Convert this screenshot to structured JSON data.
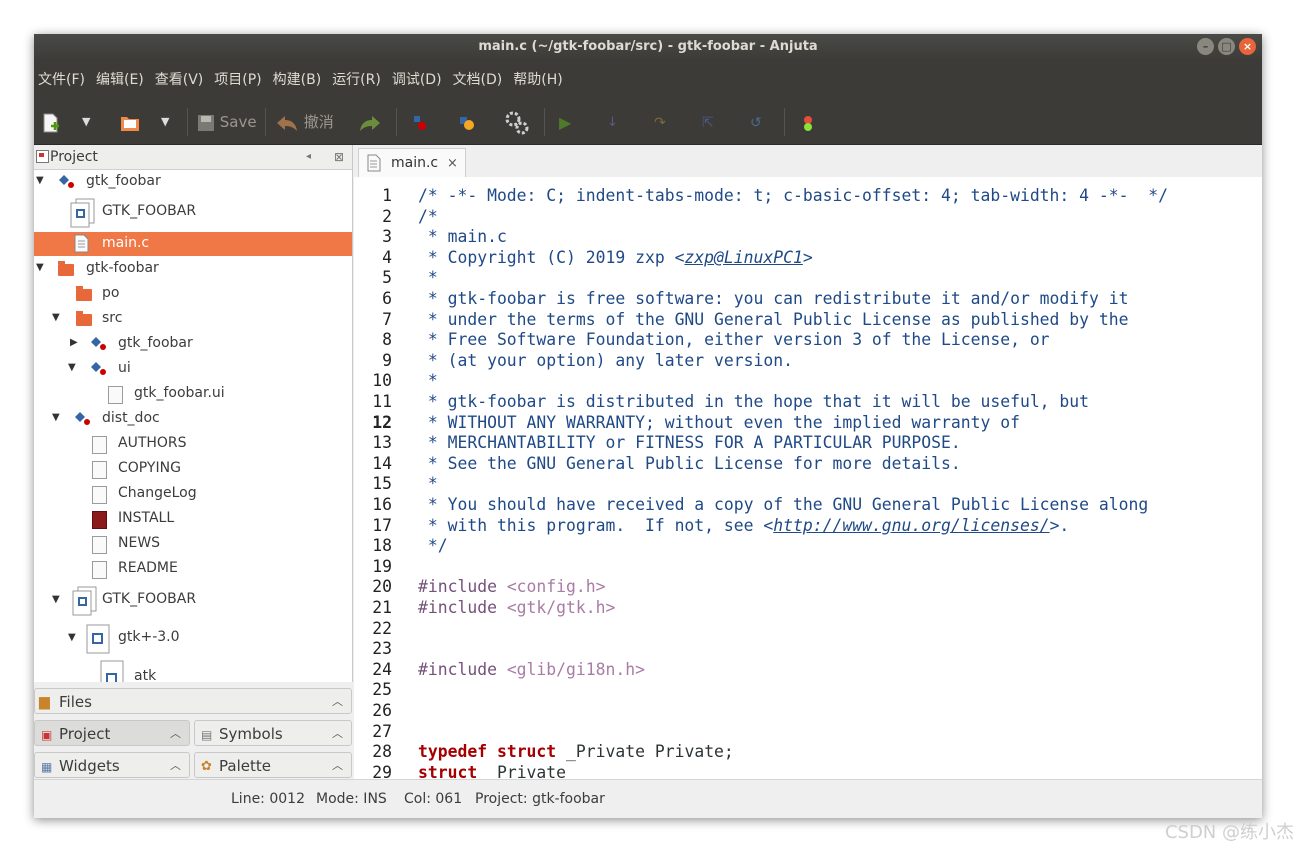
{
  "window": {
    "title": "main.c (~/gtk-foobar/src) - gtk-foobar - Anjuta"
  },
  "menu": [
    "文件(F)",
    "编辑(E)",
    "查看(V)",
    "项目(P)",
    "构建(B)",
    "运行(R)",
    "调试(D)",
    "文档(D)",
    "帮助(H)"
  ],
  "toolbar": {
    "save_label": "Save",
    "undo_label": "撤消"
  },
  "project_panel": {
    "title": "Project",
    "tree": [
      {
        "label": "gtk_foobar",
        "type": "group",
        "level": 0,
        "expanded": true
      },
      {
        "label": "GTK_FOOBAR",
        "type": "module",
        "level": 1
      },
      {
        "label": "main.c",
        "type": "file",
        "level": 1,
        "selected": true
      },
      {
        "label": "gtk-foobar",
        "type": "folder",
        "level": 0,
        "expanded": true
      },
      {
        "label": "po",
        "type": "folder",
        "level": 1
      },
      {
        "label": "src",
        "type": "folder",
        "level": 1,
        "expanded": true
      },
      {
        "label": "gtk_foobar",
        "type": "group",
        "level": 2,
        "expanded": false
      },
      {
        "label": "ui",
        "type": "group",
        "level": 2,
        "expanded": true
      },
      {
        "label": "gtk_foobar.ui",
        "type": "file",
        "level": 3
      },
      {
        "label": "dist_doc",
        "type": "group",
        "level": 1,
        "expanded": true
      },
      {
        "label": "AUTHORS",
        "type": "file",
        "level": 2
      },
      {
        "label": "COPYING",
        "type": "file",
        "level": 2
      },
      {
        "label": "ChangeLog",
        "type": "file",
        "level": 2
      },
      {
        "label": "INSTALL",
        "type": "file",
        "level": 2
      },
      {
        "label": "NEWS",
        "type": "file",
        "level": 2
      },
      {
        "label": "README",
        "type": "file",
        "level": 2
      },
      {
        "label": "GTK_FOOBAR",
        "type": "module",
        "level": 1,
        "expanded": true
      },
      {
        "label": "gtk+-3.0",
        "type": "package",
        "level": 2,
        "expanded": true
      },
      {
        "label": "atk",
        "type": "package",
        "level": 3
      }
    ]
  },
  "panel_tabs": {
    "files": "Files",
    "project": "Project",
    "symbols": "Symbols",
    "widgets": "Widgets",
    "palette": "Palette"
  },
  "editor": {
    "tab_label": "main.c",
    "current_line": 12,
    "lines": [
      [
        {
          "t": "/* -*- Mode: C; indent-tabs-mode: t; c-basic-offset: 4; tab-width: 4 -*-  */",
          "c": "cm"
        }
      ],
      [
        {
          "t": "/*",
          "c": "cm"
        }
      ],
      [
        {
          "t": " * main.c",
          "c": "cm"
        }
      ],
      [
        {
          "t": " * Copyright (C) 2019 zxp <",
          "c": "cm"
        },
        {
          "t": "zxp@LinuxPC1",
          "c": "cm ul"
        },
        {
          "t": ">",
          "c": "cm"
        }
      ],
      [
        {
          "t": " *",
          "c": "cm"
        }
      ],
      [
        {
          "t": " * gtk-foobar is free software: you can redistribute it and/or modify it",
          "c": "cm"
        }
      ],
      [
        {
          "t": " * under the terms of the GNU General Public License as published by the",
          "c": "cm"
        }
      ],
      [
        {
          "t": " * Free Software Foundation, either version 3 of the License, or",
          "c": "cm"
        }
      ],
      [
        {
          "t": " * (at your option) any later version.",
          "c": "cm"
        }
      ],
      [
        {
          "t": " *",
          "c": "cm"
        }
      ],
      [
        {
          "t": " * gtk-foobar is distributed in the hope that it will be useful, but",
          "c": "cm"
        }
      ],
      [
        {
          "t": " * WITHOUT ANY WARRANTY; without even the implied warranty of",
          "c": "cm"
        }
      ],
      [
        {
          "t": " * MERCHANTABILITY or FITNESS FOR A PARTICULAR PURPOSE.",
          "c": "cm"
        }
      ],
      [
        {
          "t": " * See the GNU General Public License for more details.",
          "c": "cm"
        }
      ],
      [
        {
          "t": " *",
          "c": "cm"
        }
      ],
      [
        {
          "t": " * You should have received a copy of the GNU General Public License along",
          "c": "cm"
        }
      ],
      [
        {
          "t": " * with this program.  If not, see <",
          "c": "cm"
        },
        {
          "t": "http://www.gnu.org/licenses/",
          "c": "cm ul"
        },
        {
          "t": ">.",
          "c": "cm"
        }
      ],
      [
        {
          "t": " */",
          "c": "cm"
        }
      ],
      [],
      [
        {
          "t": "#include ",
          "c": "pp"
        },
        {
          "t": "<config.h>",
          "c": "inc"
        }
      ],
      [
        {
          "t": "#include ",
          "c": "pp"
        },
        {
          "t": "<gtk/gtk.h>",
          "c": "inc"
        }
      ],
      [],
      [],
      [
        {
          "t": "#include ",
          "c": "pp"
        },
        {
          "t": "<glib/gi18n.h>",
          "c": "inc"
        }
      ],
      [],
      [],
      [],
      [
        {
          "t": "typedef",
          "c": "kw"
        },
        {
          "t": " ",
          "c": "plain"
        },
        {
          "t": "struct",
          "c": "kw"
        },
        {
          "t": " _Private Private;",
          "c": "plain"
        }
      ],
      [
        {
          "t": "struct",
          "c": "kw"
        },
        {
          "t": " _Private",
          "c": "plain"
        }
      ]
    ]
  },
  "statusbar": {
    "line": "Line: 0012",
    "mode": "Mode: INS",
    "col": "Col: 061",
    "project": "Project: gtk-foobar"
  },
  "watermark": "CSDN @练小杰"
}
